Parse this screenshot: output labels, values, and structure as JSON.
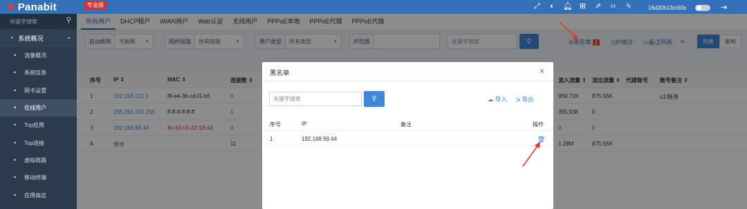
{
  "brand": {
    "name": "Panabit",
    "edition": "专业版"
  },
  "topbar": {
    "uptime": "16d20h13m50s",
    "icons": [
      "expand-icon",
      "theme-icon",
      "bell-icon",
      "grid-icon",
      "share-icon",
      "code-icon",
      "flash-icon",
      "logout-icon"
    ]
  },
  "sidebar": {
    "search_placeholder": "关键字搜索",
    "group_label": "系统概况",
    "items": [
      {
        "label": "流量概况"
      },
      {
        "label": "系统信息"
      },
      {
        "label": "网卡设置"
      },
      {
        "label": "在线用户",
        "active": true
      },
      {
        "label": "Top应用"
      },
      {
        "label": "Top连接"
      },
      {
        "label": "虚拟链路"
      },
      {
        "label": "移动终端"
      },
      {
        "label": "应用商店"
      }
    ]
  },
  "tabs": [
    {
      "label": "所有用户",
      "active": true
    },
    {
      "label": "DHCP租户"
    },
    {
      "label": "iWAN用户"
    },
    {
      "label": "Web认证"
    },
    {
      "label": "无线用户"
    },
    {
      "label": "PPPoE本地"
    },
    {
      "label": "PPPoE代理"
    },
    {
      "label": "PPPoE代拨"
    }
  ],
  "filters": {
    "auto_refresh": {
      "label": "自动刷新",
      "value": "不刷新"
    },
    "bridge_link": {
      "label": "网桥链路",
      "value": "所有链路"
    },
    "user_type": {
      "label": "用户类型",
      "value": "所有类型"
    },
    "ip_range": {
      "label": "IP范围",
      "value": ""
    },
    "keyword_placeholder": "关键字搜索"
  },
  "toolbar": {
    "blacklist_label": "黑名单",
    "blacklist_count": "1",
    "ip_stats_label": "IP统计",
    "note_list_label": "备注列表",
    "list_view_label": "列表",
    "arch_view_label": "架构"
  },
  "table": {
    "headers": {
      "index": "序号",
      "ip": "IP ⇕",
      "mac": "MAC ⇕",
      "conns": "连接数 ⇕",
      "in_flow": "流入流量 ⇕",
      "out_flow": "流出流量 ⇕",
      "proxy_account": "代拨账号",
      "account_note": "账号备注 ⇕"
    },
    "rows": [
      {
        "index": "1",
        "ip": "192.168.211.3",
        "mac": "f8-e4-3b-cd-f1-b6",
        "conns": "6",
        "in_flow": "959.71K",
        "out_flow": "875.55K",
        "proxy_account": "",
        "account_note": "s1/杨涛",
        "style": "normal"
      },
      {
        "index": "2",
        "ip": "255.255.255.255",
        "mac": "ff-ff-ff-ff-ff-ff",
        "conns": "1",
        "in_flow": "355.93K",
        "out_flow": "0",
        "proxy_account": "",
        "account_note": "",
        "style": "normal"
      },
      {
        "index": "3",
        "ip": "192.168.99.44",
        "mac": "8c-83-c0-32-18-a3",
        "conns": "4",
        "in_flow": "0",
        "out_flow": "0",
        "proxy_account": "",
        "account_note": "",
        "style": "red"
      },
      {
        "index": "4",
        "ip": "合计",
        "mac": "",
        "conns": "11",
        "in_flow": "1.28M",
        "out_flow": "875.55K",
        "proxy_account": "",
        "account_note": "",
        "style": "total"
      }
    ]
  },
  "modal": {
    "title": "黑名单",
    "search_placeholder": "关键字搜索",
    "import_label": "导入",
    "export_label": "导出",
    "headers": {
      "index": "序号",
      "ip": "IP",
      "note": "备注",
      "action": "操作"
    },
    "rows": [
      {
        "index": "1",
        "ip": "192.168.99.44",
        "note": ""
      }
    ]
  },
  "colors": {
    "topbar": "#3370b8",
    "sidebar": "#2b3a4c",
    "accent": "#3f87d8",
    "danger": "#e0332c",
    "annotation_arrow": "#e8382d"
  }
}
